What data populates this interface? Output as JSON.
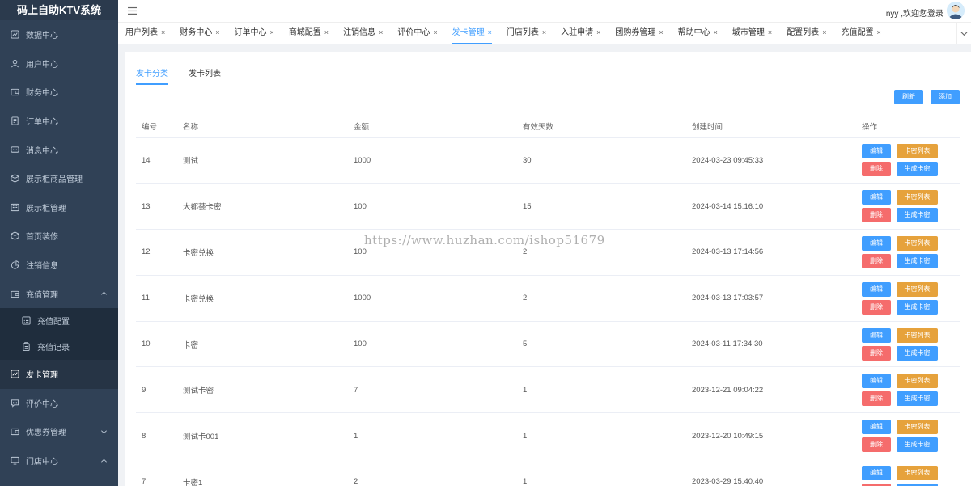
{
  "app": {
    "title": "码上自助KTV系统"
  },
  "sidebar": {
    "items": [
      {
        "label": "数据中心",
        "icon": "dashboard-icon"
      },
      {
        "label": "用户中心",
        "icon": "user-icon"
      },
      {
        "label": "财务中心",
        "icon": "wallet-icon"
      },
      {
        "label": "订单中心",
        "icon": "order-icon"
      },
      {
        "label": "消息中心",
        "icon": "message-icon"
      },
      {
        "label": "展示柜商品管理",
        "icon": "box-icon"
      },
      {
        "label": "展示柜管理",
        "icon": "cabinet-icon"
      },
      {
        "label": "首页装修",
        "icon": "cube-icon"
      },
      {
        "label": "注销信息",
        "icon": "pie-icon"
      },
      {
        "label": "充值管理",
        "icon": "wallet-icon",
        "expanded": true
      },
      {
        "label": "充值配置",
        "icon": "list-icon",
        "sub": true
      },
      {
        "label": "充值记录",
        "icon": "clipboard-icon",
        "sub": true
      },
      {
        "label": "发卡管理",
        "icon": "chart-icon",
        "active": true
      },
      {
        "label": "评价中心",
        "icon": "comment-icon"
      },
      {
        "label": "优惠券管理",
        "icon": "wallet-icon",
        "collapsed": true
      },
      {
        "label": "门店中心",
        "icon": "monitor-icon",
        "expanded": true
      }
    ]
  },
  "header": {
    "welcome": "nyy ,欢迎您登录"
  },
  "tabs": [
    {
      "label": "用户列表"
    },
    {
      "label": "财务中心"
    },
    {
      "label": "订单中心"
    },
    {
      "label": "商城配置"
    },
    {
      "label": "注销信息"
    },
    {
      "label": "评价中心"
    },
    {
      "label": "发卡管理",
      "active": true
    },
    {
      "label": "门店列表"
    },
    {
      "label": "入驻申请"
    },
    {
      "label": "团购券管理"
    },
    {
      "label": "帮助中心"
    },
    {
      "label": "城市管理"
    },
    {
      "label": "配置列表"
    },
    {
      "label": "充值配置"
    }
  ],
  "tab_close": "×",
  "inner_tabs": [
    {
      "label": "发卡分类",
      "active": true
    },
    {
      "label": "发卡列表"
    }
  ],
  "actions": {
    "refresh": "刷新",
    "add": "添加"
  },
  "table": {
    "headers": [
      "编号",
      "名称",
      "金额",
      "有效天数",
      "创建时间",
      "操作"
    ],
    "row_buttons": {
      "edit": "编辑",
      "card_list": "卡密列表",
      "delete": "删除",
      "generate": "生成卡密"
    },
    "rows": [
      {
        "id": "14",
        "name": "测试",
        "amount": "1000",
        "days": "30",
        "created": "2024-03-23 09:45:33"
      },
      {
        "id": "13",
        "name": "大都荟卡密",
        "amount": "100",
        "days": "15",
        "created": "2024-03-14 15:16:10"
      },
      {
        "id": "12",
        "name": "卡密兑换",
        "amount": "100",
        "days": "2",
        "created": "2024-03-13 17:14:56"
      },
      {
        "id": "11",
        "name": "卡密兑换",
        "amount": "1000",
        "days": "2",
        "created": "2024-03-13 17:03:57"
      },
      {
        "id": "10",
        "name": "卡密",
        "amount": "100",
        "days": "5",
        "created": "2024-03-11 17:34:30"
      },
      {
        "id": "9",
        "name": "测试卡密",
        "amount": "7",
        "days": "1",
        "created": "2023-12-21 09:04:22"
      },
      {
        "id": "8",
        "name": "测试卡001",
        "amount": "1",
        "days": "1",
        "created": "2023-12-20 10:49:15"
      },
      {
        "id": "7",
        "name": "卡密1",
        "amount": "2",
        "days": "1",
        "created": "2023-03-29 15:40:40"
      }
    ]
  },
  "watermark": "https://www.huzhan.com/ishop51679",
  "colors": {
    "sidebar_bg": "#304156",
    "primary": "#409eff",
    "warning": "#e6a23c",
    "danger": "#f56c6c"
  }
}
